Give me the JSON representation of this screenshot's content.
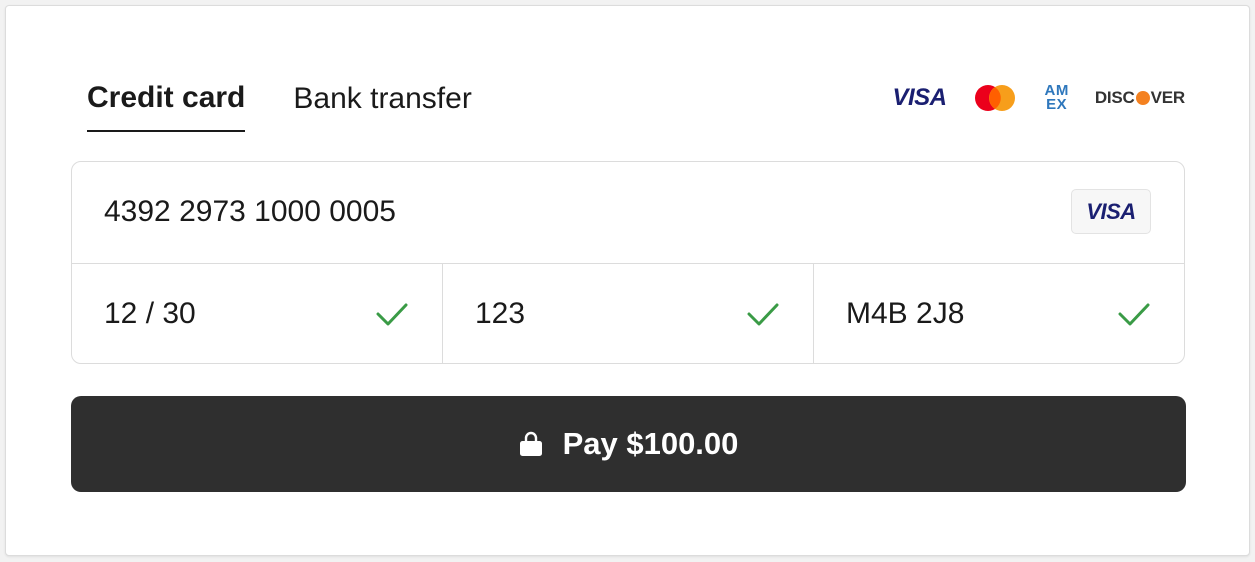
{
  "tabs": [
    {
      "label": "Credit card",
      "active": true
    },
    {
      "label": "Bank transfer",
      "active": false
    }
  ],
  "brands": {
    "visa": "VISA",
    "mastercard_icon": "mastercard-icon",
    "amex_top": "AM",
    "amex_bottom": "EX",
    "discover_pre": "DISC",
    "discover_post": "VER"
  },
  "form": {
    "card_number": "4392 2973 1000 0005",
    "detected_brand": "VISA",
    "expiry": "12 / 30",
    "cvc": "123",
    "postal_code": "M4B 2J8"
  },
  "pay_button": {
    "label": "Pay $100.00",
    "icon": "lock-icon"
  },
  "colors": {
    "button_bg": "#2f2f2f",
    "check_green": "#3a9b46",
    "visa_blue": "#1a1f71",
    "amex_blue": "#2e77bc",
    "discover_orange": "#f48120",
    "mastercard_red": "#eb001b",
    "mastercard_yellow": "#f79e1b"
  }
}
